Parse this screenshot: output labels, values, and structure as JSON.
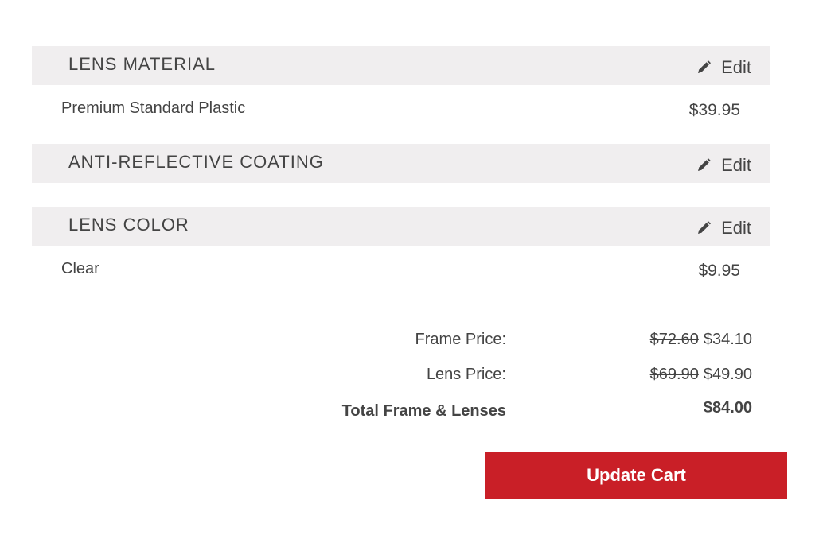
{
  "sections": [
    {
      "title": "LENS MATERIAL",
      "edit_label": "Edit",
      "icon": "pencil-icon",
      "item": {
        "label": "Premium Standard Plastic",
        "price": "$39.95"
      }
    },
    {
      "title": "ANTI-REFLECTIVE COATING",
      "edit_label": "Edit",
      "icon": "pencil-icon"
    },
    {
      "title": "LENS COLOR",
      "edit_label": "Edit",
      "icon": "pencil-icon",
      "item": {
        "label": "Clear",
        "price": "$9.95"
      }
    }
  ],
  "summary": {
    "frame_price": {
      "label": "Frame Price:",
      "original": "$72.60",
      "sale": "$34.10"
    },
    "lens_price": {
      "label": "Lens Price:",
      "original": "$69.90",
      "sale": "$49.90"
    },
    "total": {
      "label": "Total Frame & Lenses",
      "value": "$84.00"
    }
  },
  "update_button_label": "Update Cart",
  "colors": {
    "band_background": "#f0eeef",
    "button": "#c91f27",
    "text": "#444444"
  }
}
